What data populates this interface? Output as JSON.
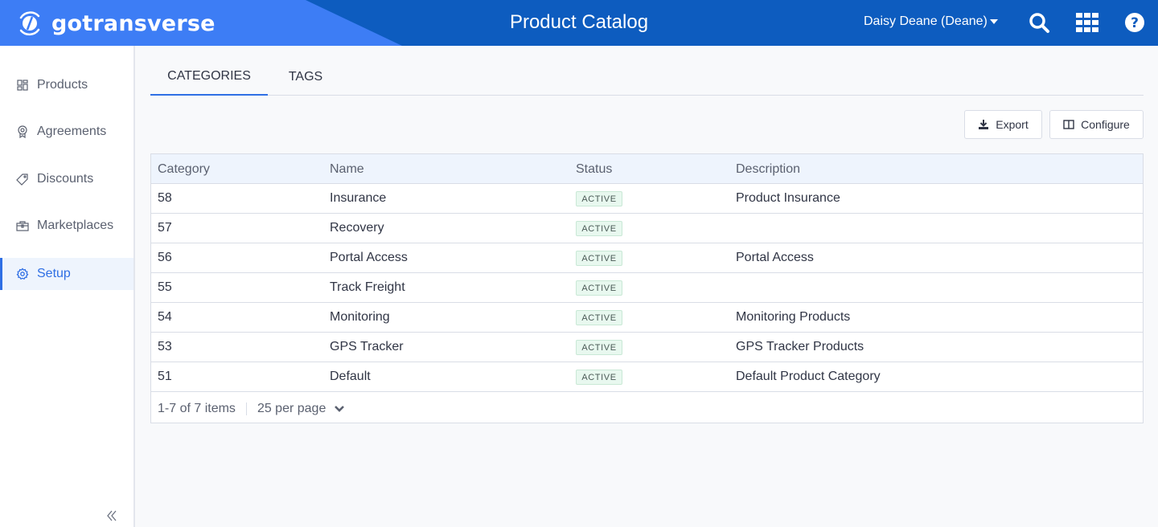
{
  "header": {
    "brand": "gotransverse",
    "title": "Product Catalog",
    "user": "Daisy Deane (Deane)",
    "icons": [
      "search-icon",
      "apps-grid-icon",
      "help-icon"
    ]
  },
  "sidebar": {
    "items": [
      {
        "label": "Products",
        "icon": "products-icon",
        "active": false
      },
      {
        "label": "Agreements",
        "icon": "agreements-icon",
        "active": false
      },
      {
        "label": "Discounts",
        "icon": "tag-icon",
        "active": false
      },
      {
        "label": "Marketplaces",
        "icon": "marketplace-icon",
        "active": false
      },
      {
        "label": "Setup",
        "icon": "gear-icon",
        "active": true
      }
    ],
    "collapse_icon": "double-chevron-left-icon"
  },
  "tabs": [
    {
      "label": "CATEGORIES",
      "active": true
    },
    {
      "label": "TAGS",
      "active": false
    }
  ],
  "toolbar": {
    "export_label": "Export",
    "configure_label": "Configure"
  },
  "table": {
    "columns": [
      "Category",
      "Name",
      "Status",
      "Description"
    ],
    "rows": [
      {
        "category": "58",
        "name": "Insurance",
        "status": "ACTIVE",
        "description": "Product Insurance"
      },
      {
        "category": "57",
        "name": "Recovery",
        "status": "ACTIVE",
        "description": ""
      },
      {
        "category": "56",
        "name": "Portal Access",
        "status": "ACTIVE",
        "description": "Portal Access"
      },
      {
        "category": "55",
        "name": "Track Freight",
        "status": "ACTIVE",
        "description": ""
      },
      {
        "category": "54",
        "name": "Monitoring",
        "status": "ACTIVE",
        "description": "Monitoring Products"
      },
      {
        "category": "53",
        "name": "GPS Tracker",
        "status": "ACTIVE",
        "description": "GPS Tracker Products"
      },
      {
        "category": "51",
        "name": "Default",
        "status": "ACTIVE",
        "description": "Default Product Category"
      }
    ]
  },
  "pager": {
    "summary": "1-7 of 7 items",
    "per_page": "25 per page"
  }
}
